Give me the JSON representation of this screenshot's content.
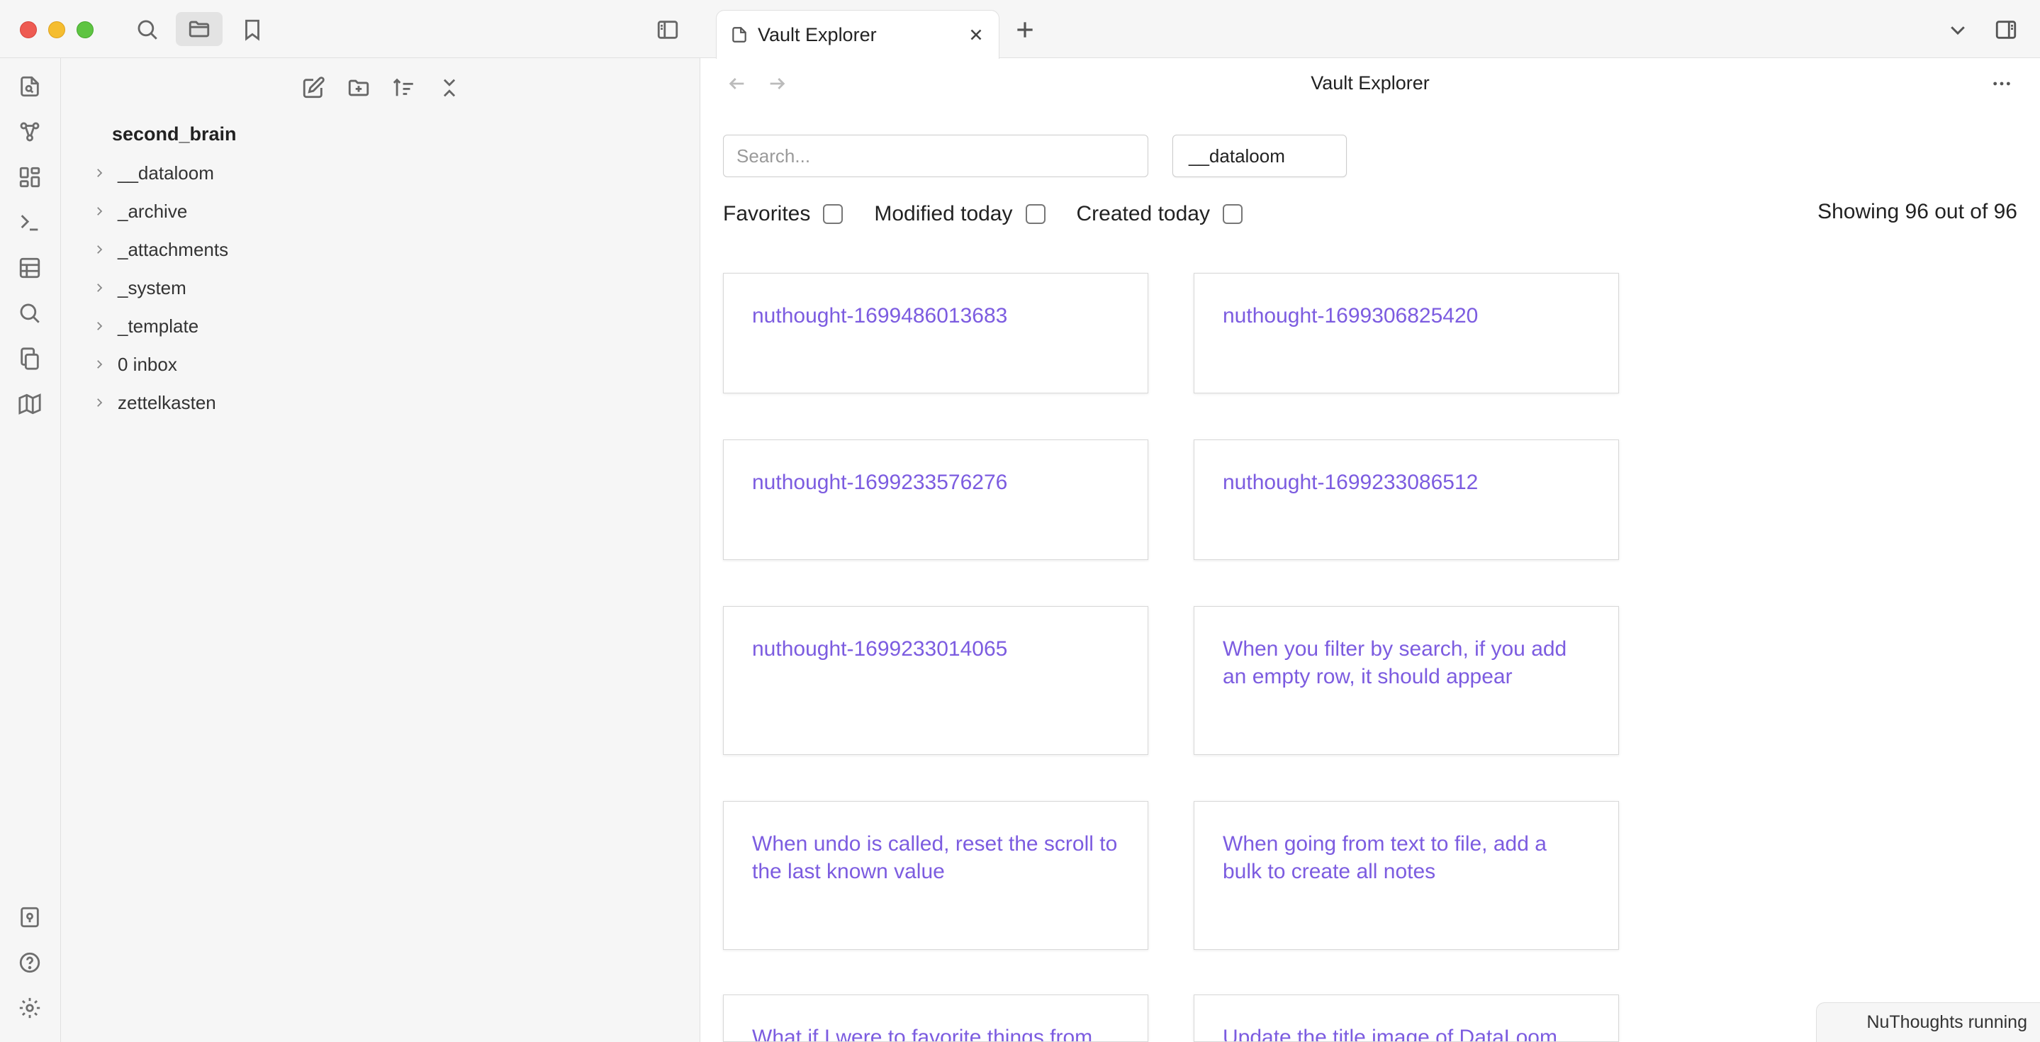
{
  "left_header": {
    "icons": [
      "search-icon",
      "folder-icon",
      "bookmark-icon",
      "sidebar-toggle-icon"
    ]
  },
  "ribbon": {
    "icons": [
      "open-quick-switcher-icon",
      "graph-view-icon",
      "canvas-icon",
      "command-palette-icon",
      "table-icon",
      "search-icon",
      "copy-icon",
      "map-icon",
      "vault-switcher-icon",
      "help-icon",
      "settings-icon"
    ]
  },
  "file_explorer": {
    "actions": [
      "new-note-icon",
      "new-folder-icon",
      "sort-icon",
      "collapse-all-icon"
    ],
    "vault_name": "second_brain",
    "folders": [
      "__dataloom",
      "_archive",
      "_attachments",
      "_system",
      "_template",
      "0 inbox",
      "zettelkasten"
    ]
  },
  "tabs": [
    {
      "label": "Vault Explorer",
      "active": true
    }
  ],
  "view": {
    "title": "Vault Explorer",
    "search_placeholder": "Search...",
    "search_value": "",
    "folder_filter": "__dataloom",
    "filters": [
      {
        "label": "Favorites",
        "checked": false
      },
      {
        "label": "Modified today",
        "checked": false
      },
      {
        "label": "Created today",
        "checked": false
      }
    ],
    "showing": "Showing 96 out of 96",
    "cards": [
      "nuthought-1699486013683",
      "nuthought-1699306825420",
      "nuthought-1699233576276",
      "nuthought-1699233086512",
      "nuthought-1699233014065",
      "When you filter by search, if you add an empty row, it should appear",
      "When undo is called, reset the scroll to the last known value",
      "When going from text to file, add a bulk to create all notes",
      "What if I were to favorite things from",
      "Update the title image of DataLoom"
    ]
  },
  "status_bar": {
    "text": "NuThoughts running"
  },
  "colors": {
    "card_title": "#7c5ce0",
    "sidebar_bg": "#f6f6f6",
    "traffic_red": "#ee5b52",
    "traffic_yellow": "#f5bd30",
    "traffic_green": "#5ec442"
  }
}
